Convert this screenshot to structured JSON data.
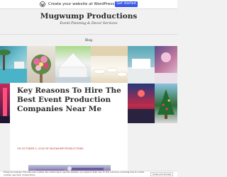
{
  "wordpress_banner": {
    "text": "Create your website at WordPress.com",
    "cta": "Get started",
    "accent_color": "#3858e9",
    "logo_icon": "wordpress-icon"
  },
  "site": {
    "title": "Mugwump Productions",
    "tagline": "Event Planning & Decor Services"
  },
  "nav": {
    "items": [
      "Blog"
    ]
  },
  "post": {
    "title": "Key Reasons To Hire The Best Event Production Companies Near Me",
    "meta": {
      "on_label": "ON",
      "date": "OCTOBER 5, 2020",
      "by_label": "BY",
      "author": "MUGWUMP PRODUCTIONS",
      "accent_color": "#c1372b"
    }
  },
  "cookie_bar": {
    "text": "Privacy & Cookies: This site uses cookies. By continuing to use this website, you agree to their use. To find out more, including how to control cookies, see here: Cookie Policy",
    "close_label": "Close and accept"
  }
}
